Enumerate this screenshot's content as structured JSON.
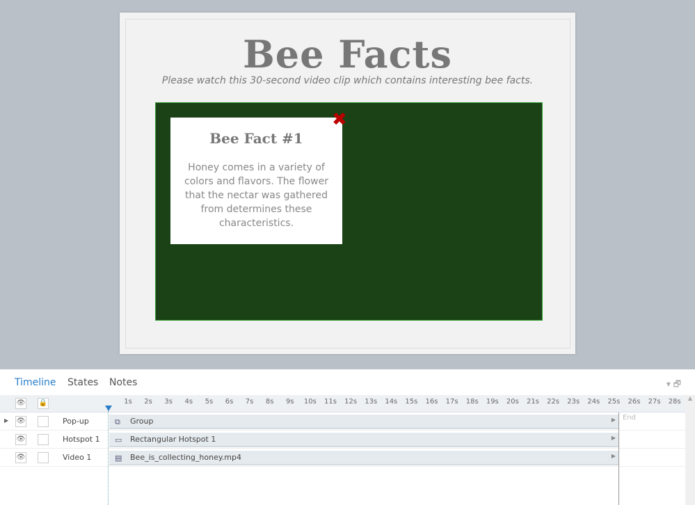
{
  "slide": {
    "title": "Bee Facts",
    "subtitle": "Please watch this 30-second video clip which contains interesting bee facts.",
    "popup": {
      "heading": "Bee Fact #1",
      "text": "Honey comes in a variety of colors and flavors. The flower that the nectar was gathered from determines these characteristics."
    }
  },
  "timeline": {
    "tabs": [
      "Timeline",
      "States",
      "Notes"
    ],
    "ticks": [
      "1s",
      "2s",
      "3s",
      "4s",
      "5s",
      "6s",
      "7s",
      "8s",
      "9s",
      "10s",
      "11s",
      "12s",
      "13s",
      "14s",
      "15s",
      "16s",
      "17s",
      "18s",
      "19s",
      "20s",
      "21s",
      "22s",
      "23s",
      "24s",
      "25s",
      "26s",
      "27s",
      "28s"
    ],
    "end_label": "End",
    "rows": [
      {
        "name": "Pop-up",
        "item": "Group"
      },
      {
        "name": "Hotspot 1",
        "item": "Rectangular Hotspot 1"
      },
      {
        "name": "Video 1",
        "item": "Bee_is_collecting_honey.mp4"
      }
    ]
  }
}
